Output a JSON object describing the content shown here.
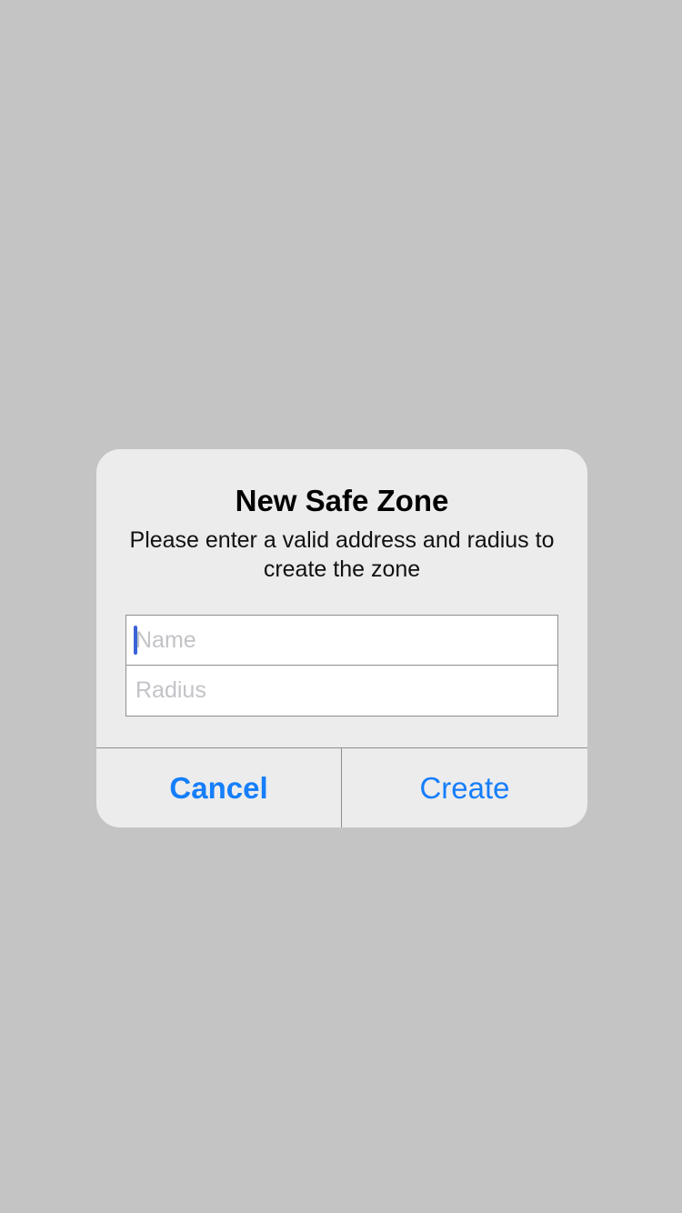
{
  "dialog": {
    "title": "New Safe Zone",
    "message": "Please enter a valid address and radius to create the zone",
    "fields": {
      "name": {
        "value": "",
        "placeholder": "Name"
      },
      "radius": {
        "value": "",
        "placeholder": "Radius"
      }
    },
    "buttons": {
      "cancel_label": "Cancel",
      "create_label": "Create"
    }
  },
  "colors": {
    "backdrop": "#c4c4c4",
    "dialog_background": "#ececec",
    "accent": "#157efb",
    "caret": "#3b63d8",
    "placeholder": "#c3c3c8"
  }
}
